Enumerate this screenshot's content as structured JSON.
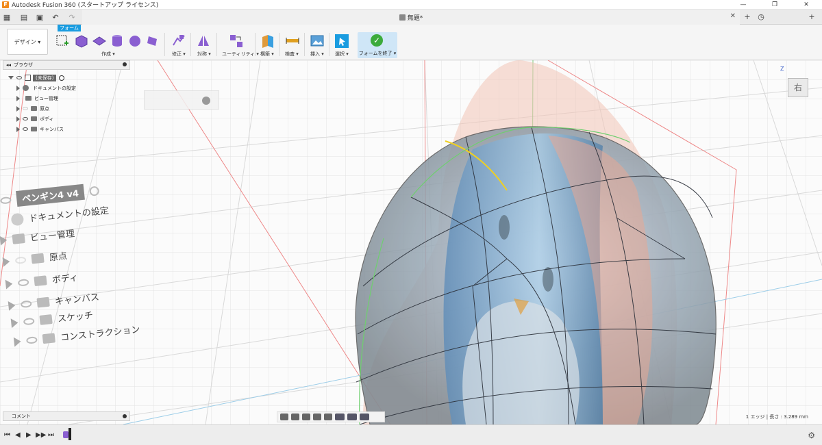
{
  "titlebar": {
    "title": "Autodesk Fusion 360 (スタートアップ ライセンス)",
    "buttons": {
      "minimize": "—",
      "maximize": "❐",
      "close": "✕"
    }
  },
  "quickaccess": {
    "items": [
      {
        "name": "grid-menu-icon",
        "glyph": "▦"
      },
      {
        "name": "file-icon",
        "glyph": "▤"
      },
      {
        "name": "save-icon",
        "glyph": "▣"
      },
      {
        "name": "undo-icon",
        "glyph": "↶"
      },
      {
        "name": "redo-icon",
        "glyph": "↷"
      }
    ]
  },
  "doc_tab": {
    "title": "無題*",
    "close": "✕"
  },
  "tab_bar_right": {
    "new_tab": "+",
    "history": "◷",
    "plus": "+"
  },
  "toolbar": {
    "workspace": "デザイン ▾",
    "active_tab": "フォーム",
    "groups": [
      {
        "label": "作成 ▾"
      },
      {
        "label": "修正 ▾"
      },
      {
        "label": "対称 ▾"
      },
      {
        "label": "ユーティリティ ▾"
      },
      {
        "label": "構築 ▾"
      },
      {
        "label": "検査 ▾"
      },
      {
        "label": "挿入 ▾"
      },
      {
        "label": "選択 ▾"
      }
    ],
    "finish_form": "フォームを終了 ▾"
  },
  "browser": {
    "header": "ブラウザ",
    "root": "(未保存)",
    "items": [
      {
        "label": "ドキュメントの設定"
      },
      {
        "label": "ビュー管理"
      },
      {
        "label": "原点"
      },
      {
        "label": "ボディ"
      },
      {
        "label": "キャンバス"
      }
    ]
  },
  "ghost_browser": {
    "root": "ペンギン4 v4",
    "items": [
      {
        "label": "ドキュメントの設定"
      },
      {
        "label": "ビュー管理"
      },
      {
        "label": "原点"
      },
      {
        "label": "ボディ"
      },
      {
        "label": "キャンバス"
      },
      {
        "label": "スケッチ"
      },
      {
        "label": "コンストラクション"
      }
    ]
  },
  "viewcube": {
    "face": "右",
    "axis": "Z"
  },
  "comment": {
    "label": "コメント"
  },
  "status": {
    "text": "1 エッジ | 長さ : 3.289 mm"
  },
  "timeline": {
    "buttons": [
      "⏮",
      "◀",
      "▶",
      "▶▶",
      "⏭"
    ]
  },
  "colors": {
    "accent": "#1a9ce0",
    "form_body": "#8fb0c8",
    "canvas_tint": "#f0b9a8",
    "finish_green": "#3cab3c"
  }
}
